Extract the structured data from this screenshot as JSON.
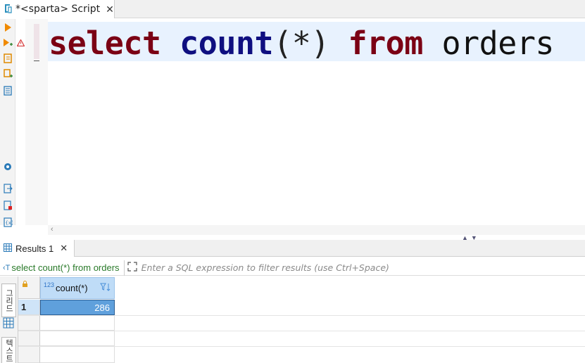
{
  "editor_tab": {
    "label": "*<sparta> Script",
    "close": "✕"
  },
  "sql": {
    "kw_select": "select",
    "fn_count": "count",
    "paren_open": "(",
    "star": "*",
    "paren_close": ")",
    "kw_from": "from",
    "table": "orders"
  },
  "results_tab": {
    "label": "Results 1",
    "close": "✕"
  },
  "filter": {
    "query_text": "select count(*) from orders",
    "placeholder": "Enter a SQL expression to filter results (use Ctrl+Space)"
  },
  "result_panel_tabs": {
    "grid_label": "그리드",
    "text_label": "텍스트"
  },
  "grid": {
    "columns": [
      {
        "type_badge": "123",
        "name": "count(*)"
      }
    ],
    "rows": [
      {
        "row_number": "1",
        "values": [
          "286"
        ]
      }
    ]
  },
  "icons": [
    "execute-statement-icon",
    "execute-script-icon",
    "explain-plan-icon",
    "load-plan-icon",
    "format-icon",
    "settings-icon",
    "export-icon",
    "import-icon",
    "variables-icon",
    "error-marker-icon",
    "lock-icon",
    "filter-sort-icon",
    "expand-icon"
  ],
  "colors": {
    "keyword": "#7b0014",
    "function": "#0f0f80",
    "selection": "#5fa0dc",
    "header": "#bfdcf7",
    "current_line": "#e8f2fe"
  }
}
